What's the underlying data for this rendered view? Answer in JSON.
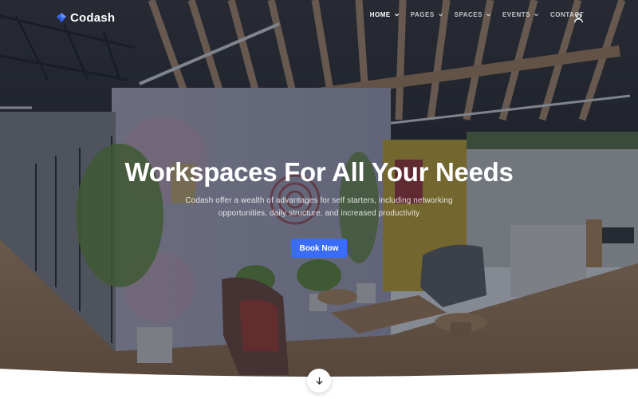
{
  "brand": {
    "name": "Codash",
    "logo_icon": "diamond-logo-icon",
    "logo_color": "#3b6cf6"
  },
  "nav": {
    "items": [
      {
        "label": "HOME",
        "active": true,
        "dropdown": true
      },
      {
        "label": "PAGES",
        "active": false,
        "dropdown": true
      },
      {
        "label": "SPACES",
        "active": false,
        "dropdown": true
      },
      {
        "label": "EVENTS",
        "active": false,
        "dropdown": true
      },
      {
        "label": "CONTACT",
        "active": false,
        "dropdown": false
      }
    ],
    "user_icon": "user-icon"
  },
  "hero": {
    "title": "Workspaces For All Your Needs",
    "subtitle": "Codash offer a wealth of advantages for self starters, including networking opportunities, daily structure, and increased productivity",
    "cta_label": "Book Now",
    "scroll_icon": "arrow-down-icon"
  },
  "colors": {
    "accent": "#3b6cf6",
    "overlay": "#161c2d"
  }
}
